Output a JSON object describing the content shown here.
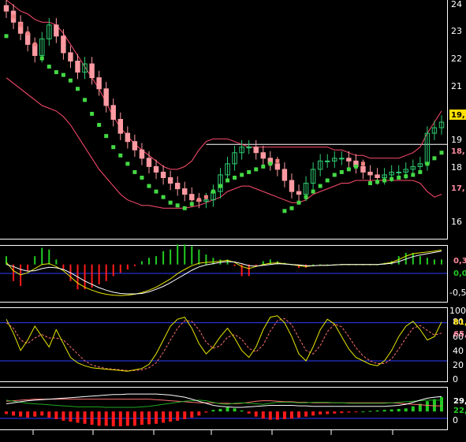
{
  "colors": {
    "background": "#000000",
    "panel_border": "#ffffff",
    "candle_up": "#2ecc71",
    "candle_down": "#ff9aa2",
    "bollinger": "#ff4d6d",
    "sar_up": "#44d944",
    "sar_down": "#f08080",
    "signal_line": "#ffffff",
    "yellow_line": "#e8e800",
    "red_dashed": "#ff7070",
    "guide_line": "#2b3cff",
    "hist_pos": "#22cc22",
    "hist_neg": "#ff1a1a",
    "white_line": "#ffffff",
    "green_line": "#22aa22"
  },
  "chart_data": [
    {
      "type": "candlestick",
      "panel": "price",
      "yticks": [
        "24",
        "23",
        "22",
        "21",
        "19",
        "18",
        "16"
      ],
      "tags": [
        {
          "text": "19,",
          "bg": "#ffe000",
          "fg": "#000000"
        },
        {
          "text": "18,",
          "bg": "#000000",
          "fg": "#ff8aa0"
        },
        {
          "text": "17,",
          "bg": "#000000",
          "fg": "#ff8aa0"
        }
      ],
      "ylim": [
        15.6,
        24.2
      ],
      "horizontal_line": 19.0,
      "close": [
        23.8,
        23.4,
        23.0,
        22.6,
        22.2,
        22.8,
        23.3,
        22.9,
        22.3,
        22.0,
        21.6,
        21.9,
        21.4,
        21.0,
        20.4,
        19.9,
        19.4,
        19.1,
        18.8,
        18.5,
        18.2,
        18.0,
        17.8,
        17.6,
        17.4,
        17.2,
        17.0,
        16.95,
        17.0,
        17.3,
        17.9,
        18.3,
        18.7,
        18.9,
        18.9,
        18.7,
        18.5,
        18.3,
        18.1,
        17.7,
        17.3,
        17.2,
        17.6,
        18.1,
        18.4,
        18.4,
        18.5,
        18.5,
        18.4,
        18.2,
        18.0,
        17.9,
        17.8,
        17.9,
        18.0,
        18.0,
        18.1,
        18.2,
        18.3,
        19.4,
        19.6,
        19.8
      ],
      "bb_upper": [
        24.2,
        24.0,
        23.8,
        23.7,
        23.5,
        23.4,
        23.4,
        23.3,
        23.0,
        22.6,
        22.2,
        21.8,
        21.4,
        21.0,
        20.5,
        20.0,
        19.6,
        19.3,
        19.0,
        18.8,
        18.6,
        18.4,
        18.2,
        18.1,
        18.1,
        18.2,
        18.4,
        18.8,
        19.1,
        19.2,
        19.2,
        19.2,
        19.1,
        19.0,
        18.9,
        18.9,
        18.9,
        18.9,
        18.9,
        18.9,
        18.9,
        18.9,
        18.9,
        18.9,
        18.9,
        18.9,
        18.8,
        18.8,
        18.7,
        18.6,
        18.6,
        18.5,
        18.5,
        18.5,
        18.5,
        18.5,
        18.6,
        18.7,
        18.9,
        19.4,
        19.8,
        20.2
      ],
      "bb_lower": [
        21.4,
        21.2,
        21.0,
        20.8,
        20.6,
        20.4,
        20.3,
        20.2,
        20.0,
        19.7,
        19.3,
        18.9,
        18.5,
        18.1,
        17.8,
        17.5,
        17.2,
        17.0,
        16.9,
        16.8,
        16.8,
        16.75,
        16.7,
        16.7,
        16.7,
        16.7,
        16.75,
        16.8,
        16.9,
        17.0,
        17.1,
        17.3,
        17.4,
        17.5,
        17.5,
        17.4,
        17.3,
        17.2,
        17.1,
        17.0,
        16.9,
        16.9,
        17.0,
        17.2,
        17.3,
        17.4,
        17.5,
        17.6,
        17.6,
        17.7,
        17.7,
        17.7,
        17.7,
        17.7,
        17.7,
        17.7,
        17.7,
        17.7,
        17.6,
        17.3,
        17.1,
        17.2
      ],
      "sar": [
        22.9,
        23.6,
        23.3,
        23.0,
        22.6,
        22.1,
        21.8,
        21.6,
        21.5,
        21.3,
        21.0,
        20.6,
        20.1,
        19.7,
        19.3,
        18.9,
        18.6,
        18.3,
        18.0,
        17.8,
        17.5,
        17.3,
        17.1,
        16.9,
        16.8,
        16.7,
        16.85,
        17.0,
        17.1,
        17.3,
        17.5,
        17.7,
        17.8,
        17.9,
        18.0,
        18.1,
        18.2,
        18.3,
        18.4,
        16.6,
        16.7,
        16.9,
        17.1,
        17.3,
        17.5,
        17.7,
        17.9,
        18.0,
        18.1,
        18.2,
        18.3,
        17.6,
        17.65,
        17.7,
        17.75,
        17.8,
        17.85,
        17.9,
        18.0,
        18.3,
        18.5,
        18.7
      ]
    },
    {
      "type": "line",
      "panel": "macd",
      "yticks": [
        "0,3",
        "0,0",
        "-0,5"
      ],
      "ylim": [
        -0.9,
        0.45
      ],
      "macd": [
        0.05,
        -0.15,
        -0.25,
        -0.2,
        -0.1,
        0.0,
        0.02,
        -0.05,
        -0.15,
        -0.3,
        -0.45,
        -0.55,
        -0.62,
        -0.68,
        -0.72,
        -0.74,
        -0.75,
        -0.74,
        -0.72,
        -0.68,
        -0.62,
        -0.55,
        -0.45,
        -0.35,
        -0.22,
        -0.12,
        -0.03,
        0.03,
        0.05,
        0.06,
        0.08,
        0.1,
        0.05,
        -0.05,
        -0.1,
        -0.05,
        0.0,
        0.03,
        0.04,
        0.02,
        0.0,
        -0.03,
        -0.05,
        -0.03,
        -0.02,
        -0.02,
        -0.01,
        0.0,
        0.0,
        0.0,
        0.0,
        0.0,
        0.0,
        0.02,
        0.05,
        0.12,
        0.2,
        0.26,
        0.28,
        0.3,
        0.32,
        0.35
      ],
      "signal": [
        0.0,
        -0.05,
        -0.12,
        -0.16,
        -0.15,
        -0.1,
        -0.07,
        -0.08,
        -0.12,
        -0.2,
        -0.3,
        -0.4,
        -0.48,
        -0.56,
        -0.62,
        -0.67,
        -0.7,
        -0.71,
        -0.71,
        -0.7,
        -0.66,
        -0.6,
        -0.53,
        -0.44,
        -0.34,
        -0.24,
        -0.14,
        -0.06,
        -0.01,
        0.02,
        0.05,
        0.07,
        0.06,
        0.02,
        -0.03,
        -0.04,
        -0.02,
        0.0,
        0.02,
        0.01,
        0.0,
        -0.01,
        -0.03,
        -0.03,
        -0.02,
        -0.02,
        -0.01,
        0.0,
        0.0,
        0.0,
        0.0,
        0.0,
        0.0,
        0.01,
        0.03,
        0.07,
        0.13,
        0.19,
        0.23,
        0.26,
        0.29,
        0.32
      ]
    },
    {
      "type": "line",
      "panel": "stochastic",
      "yticks": [
        "100",
        "80",
        "60",
        "40",
        "20",
        "0"
      ],
      "tags": [
        {
          "text": "81,",
          "bg": "#000000",
          "fg": "#ffe000"
        },
        {
          "text": "65,",
          "bg": "#000000",
          "fg": "#ff8aa0"
        }
      ],
      "ylim": [
        0,
        100
      ],
      "guides": [
        80,
        25
      ],
      "k": [
        85,
        65,
        40,
        55,
        75,
        60,
        45,
        70,
        50,
        30,
        22,
        18,
        15,
        14,
        13,
        12,
        11,
        10,
        12,
        14,
        20,
        35,
        55,
        75,
        85,
        88,
        72,
        50,
        35,
        45,
        60,
        72,
        58,
        40,
        30,
        45,
        70,
        88,
        90,
        80,
        60,
        35,
        25,
        45,
        70,
        85,
        78,
        60,
        42,
        30,
        25,
        20,
        18,
        25,
        40,
        60,
        75,
        82,
        70,
        55,
        60,
        81
      ],
      "d": [
        80,
        72,
        55,
        50,
        58,
        63,
        58,
        58,
        55,
        45,
        35,
        25,
        19,
        16,
        14,
        13,
        12,
        11,
        11,
        12,
        15,
        22,
        37,
        55,
        72,
        83,
        82,
        70,
        52,
        43,
        47,
        59,
        63,
        56,
        43,
        38,
        48,
        68,
        83,
        86,
        77,
        58,
        40,
        35,
        47,
        67,
        78,
        74,
        60,
        44,
        32,
        25,
        21,
        21,
        28,
        42,
        58,
        72,
        76,
        69,
        62,
        65
      ]
    },
    {
      "type": "bar",
      "panel": "adx",
      "yticks": [
        "29,",
        "22,",
        "0"
      ],
      "tags": [
        {
          "text": "29,",
          "bg": "#000000",
          "fg": "#ffffff"
        },
        {
          "text": "22,",
          "bg": "#000000",
          "fg": "#22cc22"
        }
      ],
      "ylim": [
        -35,
        45
      ],
      "histogram": [
        -5,
        -8,
        -10,
        -12,
        -10,
        -8,
        -12,
        -15,
        -18,
        -20,
        -22,
        -24,
        -26,
        -28,
        -28,
        -29,
        -29,
        -28,
        -28,
        -26,
        -25,
        -24,
        -22,
        -20,
        -18,
        -15,
        -12,
        -8,
        -2,
        3,
        5,
        8,
        6,
        2,
        -4,
        -10,
        -14,
        -16,
        -16,
        -15,
        -14,
        -12,
        -10,
        -8,
        -6,
        -5,
        -4,
        -3,
        -2,
        -1,
        0,
        1,
        2,
        3,
        4,
        5,
        6,
        10,
        15,
        20,
        24,
        28
      ],
      "adx_line": [
        15,
        17,
        19,
        21,
        22,
        23,
        24,
        25,
        26,
        27,
        28,
        29,
        30,
        31,
        32,
        33,
        33,
        34,
        34,
        34,
        34,
        34,
        33,
        32,
        30,
        28,
        24,
        20,
        16,
        12,
        10,
        9,
        8,
        8,
        9,
        10,
        11,
        12,
        12,
        12,
        12,
        11,
        11,
        10,
        10,
        10,
        10,
        10,
        10,
        10,
        10,
        10,
        10,
        10,
        11,
        12,
        14,
        18,
        22,
        26,
        28,
        29
      ],
      "di_plus": [
        22,
        20,
        18,
        16,
        15,
        14,
        13,
        12,
        11,
        10,
        9,
        9,
        9,
        9,
        8,
        8,
        8,
        8,
        8,
        9,
        10,
        12,
        14,
        16,
        18,
        20,
        21,
        22,
        21,
        18,
        15,
        14,
        16,
        17,
        16,
        15,
        14,
        16,
        18,
        18,
        18,
        17,
        17,
        18,
        18,
        18,
        17,
        17,
        16,
        16,
        16,
        16,
        16,
        16,
        17,
        18,
        19,
        20,
        21,
        22,
        22,
        22
      ],
      "di_minus": [
        20,
        21,
        22,
        23,
        24,
        24,
        24,
        24,
        24,
        24,
        24,
        24,
        24,
        24,
        24,
        24,
        24,
        24,
        24,
        24,
        24,
        23,
        22,
        21,
        20,
        19,
        18,
        17,
        17,
        17,
        16,
        16,
        15,
        16,
        18,
        20,
        21,
        21,
        20,
        19,
        19,
        18,
        18,
        17,
        17,
        17,
        17,
        17,
        17,
        17,
        17,
        17,
        17,
        17,
        17,
        16,
        15,
        14,
        13,
        12,
        11,
        11
      ]
    }
  ]
}
